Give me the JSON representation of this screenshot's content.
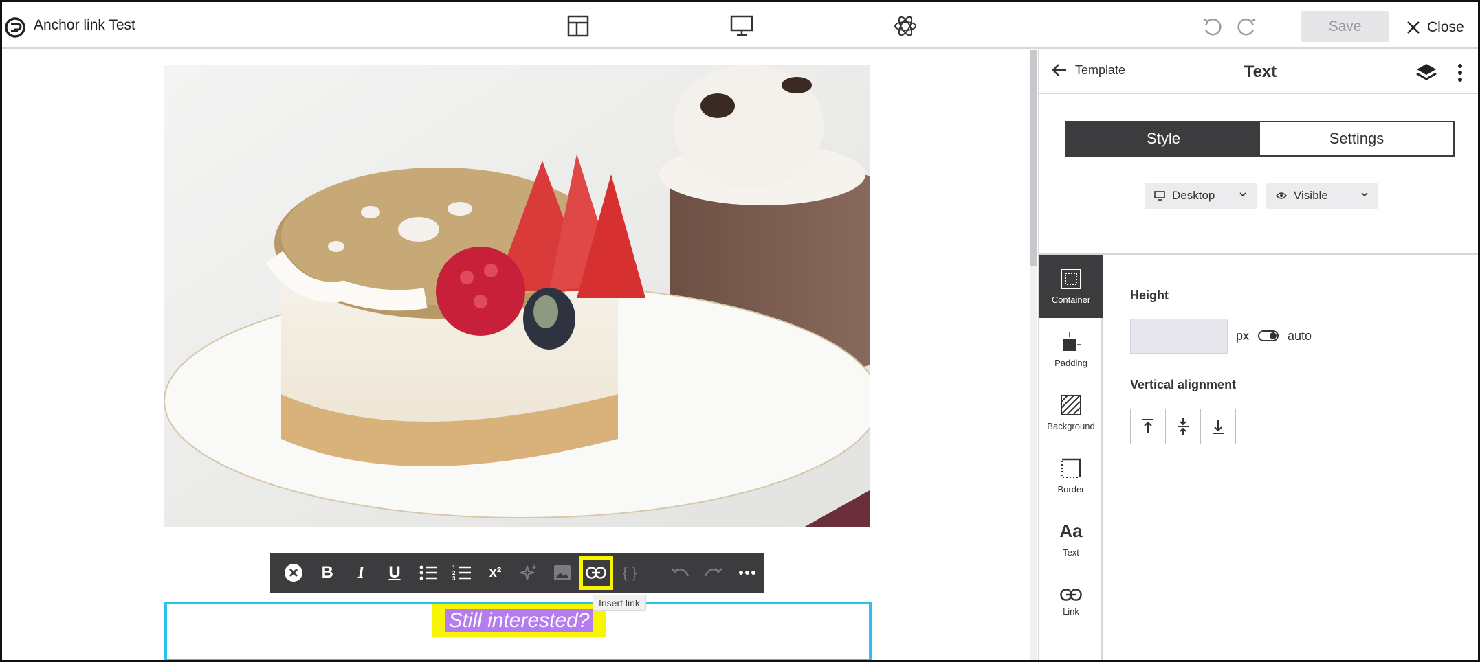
{
  "app": {
    "document_title": "Anchor link Test",
    "save_label": "Save",
    "close_label": "Close"
  },
  "canvas": {
    "selected_text": "Still interested?",
    "tooltip": "Insert link"
  },
  "toolbar": {
    "items": [
      "clear-format",
      "bold",
      "italic",
      "underline",
      "bulleted-list",
      "numbered-list",
      "superscript",
      "ai-assist",
      "image",
      "insert-link",
      "merge-tag",
      "undo",
      "redo",
      "more"
    ],
    "bold_label": "B",
    "italic_label": "I",
    "underline_label": "U",
    "superscript_label": "x²",
    "merge_tag_label": "{ }"
  },
  "panel": {
    "back_label": "Template",
    "title": "Text",
    "tabs": [
      {
        "label": "Style",
        "active": true
      },
      {
        "label": "Settings",
        "active": false
      }
    ],
    "device_dropdown": "Desktop",
    "visibility_dropdown": "Visible",
    "nav": [
      {
        "label": "Container",
        "icon": "container-icon",
        "active": true
      },
      {
        "label": "Padding",
        "icon": "padding-icon",
        "active": false
      },
      {
        "label": "Background",
        "icon": "background-icon",
        "active": false
      },
      {
        "label": "Border",
        "icon": "border-icon",
        "active": false
      },
      {
        "label": "Text",
        "icon": "text-icon",
        "active": false,
        "glyph": "Aa"
      },
      {
        "label": "Link",
        "icon": "link-icon",
        "active": false
      }
    ],
    "height_label": "Height",
    "height_value": "",
    "height_unit": "px",
    "auto_label": "auto",
    "vertical_alignment_label": "Vertical alignment"
  },
  "colors": {
    "dark": "#3c3c3f",
    "selection_outline": "#28c3e8",
    "highlight": "#f7f500",
    "text_highlight": "#b57cf0"
  }
}
